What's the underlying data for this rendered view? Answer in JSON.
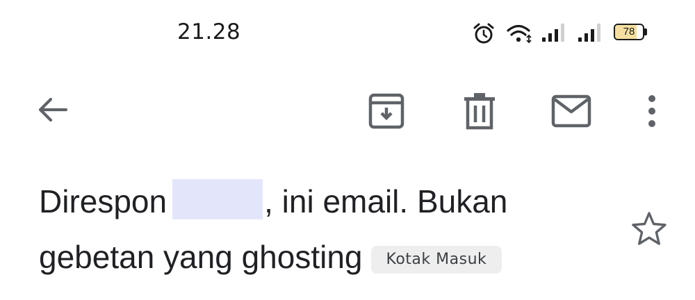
{
  "status_bar": {
    "time": "21.28",
    "battery_level": "78",
    "icons": [
      "alarm-icon",
      "wifi-icon",
      "signal-icon",
      "signal-icon",
      "battery-icon"
    ]
  },
  "toolbar": {
    "icons": [
      "back-arrow-icon",
      "archive-icon",
      "trash-icon",
      "mail-icon",
      "more-vert-icon"
    ]
  },
  "email": {
    "subject_part1": "Direspon",
    "subject_part2": ", ini email. Bukan gebetan yang ghosting",
    "label": "Kotak Masuk",
    "star_icon": "star-outline-icon"
  },
  "colors": {
    "icon": "#5f6368",
    "text": "#202124",
    "chip_bg": "#eeeeee",
    "redaction": "#e3e6fb",
    "battery_fill": "#f4dfa0"
  }
}
